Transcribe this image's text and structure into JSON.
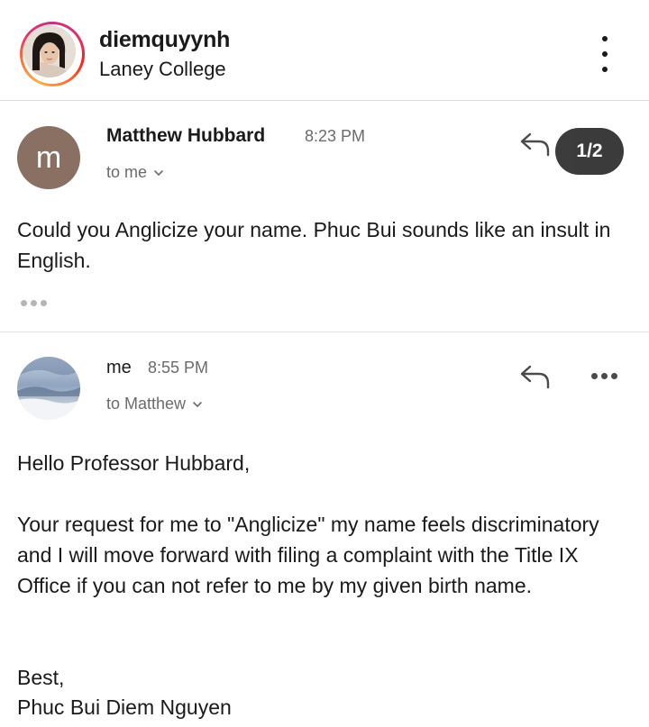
{
  "post_header": {
    "username": "diemquyynh",
    "subtitle": "Laney College",
    "more_icon": "more-vertical-icon"
  },
  "page_indicator": "1/2",
  "emails": [
    {
      "avatar_letter": "m",
      "sender": "Matthew Hubbard",
      "time": "8:23 PM",
      "to": "to me",
      "body": "Could you Anglicize your name. Phuc Bui sounds like an insult in English.",
      "reply_icon": "reply-icon",
      "trimmed_icon": "ellipsis-icon"
    },
    {
      "sender": "me",
      "time": "8:55 PM",
      "to": "to Matthew",
      "greeting": "Hello Professor Hubbard,",
      "paragraph": "Your request for me to \"Anglicize\" my name feels discriminatory and I will move forward with filing a complaint with the Title IX Office if you can not refer to me by my given birth name.",
      "closing": "Best,",
      "signature": "Phuc Bui Diem Nguyen",
      "reply_icon": "reply-icon",
      "more_icon": "more-horizontal-icon"
    }
  ],
  "colors": {
    "avatar_m": "#8a6f63",
    "muted_text": "#6b6b6b",
    "indicator_bg": "#2b2b2b"
  }
}
